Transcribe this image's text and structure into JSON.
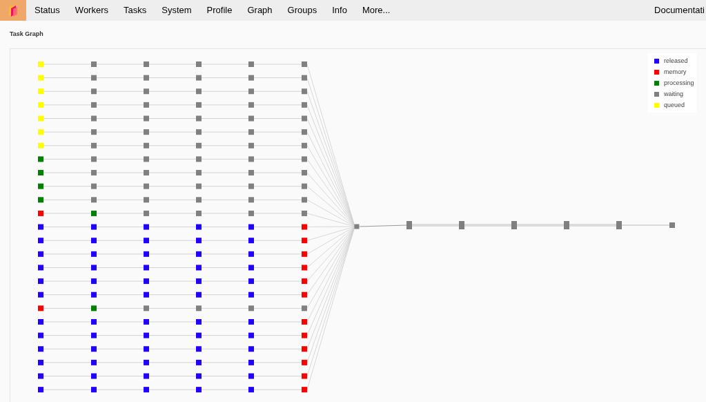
{
  "nav": {
    "items": [
      {
        "label": "Status"
      },
      {
        "label": "Workers"
      },
      {
        "label": "Tasks"
      },
      {
        "label": "System"
      },
      {
        "label": "Profile"
      },
      {
        "label": "Graph"
      },
      {
        "label": "Groups"
      },
      {
        "label": "Info"
      },
      {
        "label": "More..."
      }
    ],
    "right_link": "Documentati"
  },
  "page_title": "Task Graph",
  "legend": [
    {
      "state": "released",
      "color": "#2200ff"
    },
    {
      "state": "memory",
      "color": "#ff0000"
    },
    {
      "state": "processing",
      "color": "#008000"
    },
    {
      "state": "waiting",
      "color": "#808080"
    },
    {
      "state": "queued",
      "color": "#ffff00"
    }
  ],
  "graph": {
    "rows": [
      [
        {
          "color": "#ffff00"
        },
        {
          "color": "#808080"
        },
        {
          "color": "#808080"
        },
        {
          "color": "#808080"
        },
        {
          "color": "#808080"
        },
        {
          "color": "#808080"
        }
      ],
      [
        {
          "color": "#ffff00"
        },
        {
          "color": "#808080"
        },
        {
          "color": "#808080"
        },
        {
          "color": "#808080"
        },
        {
          "color": "#808080"
        },
        {
          "color": "#808080"
        }
      ],
      [
        {
          "color": "#ffff00"
        },
        {
          "color": "#808080"
        },
        {
          "color": "#808080"
        },
        {
          "color": "#808080"
        },
        {
          "color": "#808080"
        },
        {
          "color": "#808080"
        }
      ],
      [
        {
          "color": "#ffff00"
        },
        {
          "color": "#808080"
        },
        {
          "color": "#808080"
        },
        {
          "color": "#808080"
        },
        {
          "color": "#808080"
        },
        {
          "color": "#808080"
        }
      ],
      [
        {
          "color": "#ffff00"
        },
        {
          "color": "#808080"
        },
        {
          "color": "#808080"
        },
        {
          "color": "#808080"
        },
        {
          "color": "#808080"
        },
        {
          "color": "#808080"
        }
      ],
      [
        {
          "color": "#ffff00"
        },
        {
          "color": "#808080"
        },
        {
          "color": "#808080"
        },
        {
          "color": "#808080"
        },
        {
          "color": "#808080"
        },
        {
          "color": "#808080"
        }
      ],
      [
        {
          "color": "#ffff00"
        },
        {
          "color": "#808080"
        },
        {
          "color": "#808080"
        },
        {
          "color": "#808080"
        },
        {
          "color": "#808080"
        },
        {
          "color": "#808080"
        }
      ],
      [
        {
          "color": "#008000"
        },
        {
          "color": "#808080"
        },
        {
          "color": "#808080"
        },
        {
          "color": "#808080"
        },
        {
          "color": "#808080"
        },
        {
          "color": "#808080"
        }
      ],
      [
        {
          "color": "#008000"
        },
        {
          "color": "#808080"
        },
        {
          "color": "#808080"
        },
        {
          "color": "#808080"
        },
        {
          "color": "#808080"
        },
        {
          "color": "#808080"
        }
      ],
      [
        {
          "color": "#008000"
        },
        {
          "color": "#808080"
        },
        {
          "color": "#808080"
        },
        {
          "color": "#808080"
        },
        {
          "color": "#808080"
        },
        {
          "color": "#808080"
        }
      ],
      [
        {
          "color": "#008000"
        },
        {
          "color": "#808080"
        },
        {
          "color": "#808080"
        },
        {
          "color": "#808080"
        },
        {
          "color": "#808080"
        },
        {
          "color": "#808080"
        }
      ],
      [
        {
          "color": "#ff0000"
        },
        {
          "color": "#008000"
        },
        {
          "color": "#808080"
        },
        {
          "color": "#808080"
        },
        {
          "color": "#808080"
        },
        {
          "color": "#808080"
        }
      ],
      [
        {
          "color": "#2200ff"
        },
        {
          "color": "#2200ff"
        },
        {
          "color": "#2200ff"
        },
        {
          "color": "#2200ff"
        },
        {
          "color": "#2200ff"
        },
        {
          "color": "#ff0000"
        }
      ],
      [
        {
          "color": "#2200ff"
        },
        {
          "color": "#2200ff"
        },
        {
          "color": "#2200ff"
        },
        {
          "color": "#2200ff"
        },
        {
          "color": "#2200ff"
        },
        {
          "color": "#ff0000"
        }
      ],
      [
        {
          "color": "#2200ff"
        },
        {
          "color": "#2200ff"
        },
        {
          "color": "#2200ff"
        },
        {
          "color": "#2200ff"
        },
        {
          "color": "#2200ff"
        },
        {
          "color": "#ff0000"
        }
      ],
      [
        {
          "color": "#2200ff"
        },
        {
          "color": "#2200ff"
        },
        {
          "color": "#2200ff"
        },
        {
          "color": "#2200ff"
        },
        {
          "color": "#2200ff"
        },
        {
          "color": "#ff0000"
        }
      ],
      [
        {
          "color": "#2200ff"
        },
        {
          "color": "#2200ff"
        },
        {
          "color": "#2200ff"
        },
        {
          "color": "#2200ff"
        },
        {
          "color": "#2200ff"
        },
        {
          "color": "#ff0000"
        }
      ],
      [
        {
          "color": "#2200ff"
        },
        {
          "color": "#2200ff"
        },
        {
          "color": "#2200ff"
        },
        {
          "color": "#2200ff"
        },
        {
          "color": "#2200ff"
        },
        {
          "color": "#ff0000"
        }
      ],
      [
        {
          "color": "#ff0000"
        },
        {
          "color": "#008000"
        },
        {
          "color": "#808080"
        },
        {
          "color": "#808080"
        },
        {
          "color": "#808080"
        },
        {
          "color": "#808080"
        }
      ],
      [
        {
          "color": "#2200ff"
        },
        {
          "color": "#2200ff"
        },
        {
          "color": "#2200ff"
        },
        {
          "color": "#2200ff"
        },
        {
          "color": "#2200ff"
        },
        {
          "color": "#ff0000"
        }
      ],
      [
        {
          "color": "#2200ff"
        },
        {
          "color": "#2200ff"
        },
        {
          "color": "#2200ff"
        },
        {
          "color": "#2200ff"
        },
        {
          "color": "#2200ff"
        },
        {
          "color": "#ff0000"
        }
      ],
      [
        {
          "color": "#2200ff"
        },
        {
          "color": "#2200ff"
        },
        {
          "color": "#2200ff"
        },
        {
          "color": "#2200ff"
        },
        {
          "color": "#2200ff"
        },
        {
          "color": "#ff0000"
        }
      ],
      [
        {
          "color": "#2200ff"
        },
        {
          "color": "#2200ff"
        },
        {
          "color": "#2200ff"
        },
        {
          "color": "#2200ff"
        },
        {
          "color": "#2200ff"
        },
        {
          "color": "#ff0000"
        }
      ],
      [
        {
          "color": "#2200ff"
        },
        {
          "color": "#2200ff"
        },
        {
          "color": "#2200ff"
        },
        {
          "color": "#2200ff"
        },
        {
          "color": "#2200ff"
        },
        {
          "color": "#ff0000"
        }
      ],
      [
        {
          "color": "#2200ff"
        },
        {
          "color": "#2200ff"
        },
        {
          "color": "#2200ff"
        },
        {
          "color": "#2200ff"
        },
        {
          "color": "#2200ff"
        },
        {
          "color": "#ff0000"
        }
      ]
    ],
    "chain": [
      {
        "color": "#808080"
      },
      {
        "color": "#808080"
      },
      {
        "color": "#808080"
      },
      {
        "color": "#808080"
      },
      {
        "color": "#808080"
      },
      {
        "color": "#808080"
      },
      {
        "color": "#808080"
      }
    ]
  }
}
